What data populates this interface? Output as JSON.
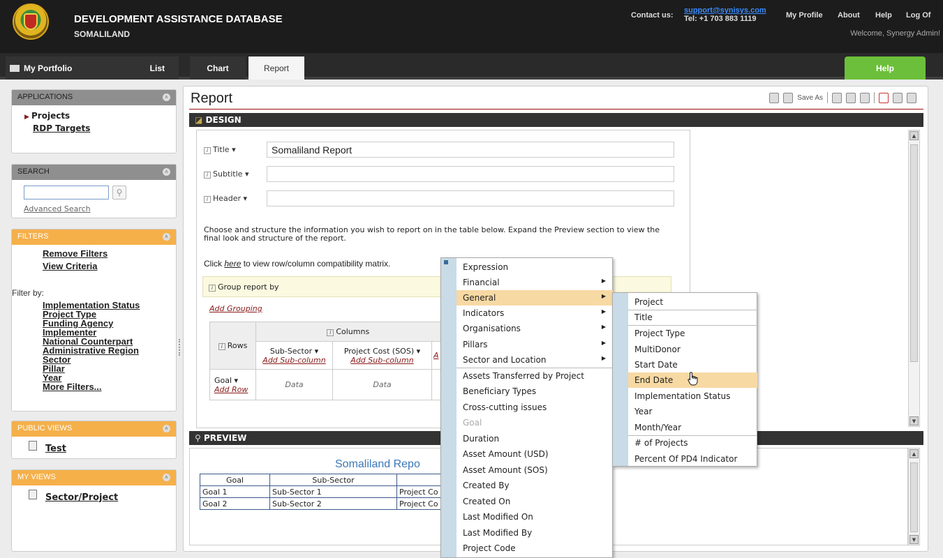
{
  "header": {
    "app_title": "DEVELOPMENT ASSISTANCE DATABASE",
    "app_subtitle": "SOMALILAND",
    "contact_label": "Contact us:",
    "contact_email": "support@synisys.com",
    "contact_tel": "Tel: +1 703 883 1119",
    "links": [
      "My Profile",
      "About",
      "Help",
      "Log Of"
    ],
    "welcome": "Welcome, Synergy Admin!"
  },
  "nav": {
    "portfolio": "My Portfolio",
    "list": "List",
    "chart": "Chart",
    "report": "Report",
    "help": "Help"
  },
  "sidebar": {
    "applications": {
      "title": "APPLICATIONS",
      "items": [
        "Projects",
        "RDP Targets"
      ]
    },
    "search": {
      "title": "SEARCH",
      "value": "",
      "advanced": "Advanced Search"
    },
    "filters": {
      "title": "FILTERS",
      "remove": "Remove Filters",
      "view": "View Criteria",
      "filter_by": "Filter by:",
      "items": [
        "Implementation Status",
        "Project Type",
        "Funding Agency",
        "Implementer",
        "National Counterpart",
        "Administrative Region",
        "Sector",
        "Pillar",
        "Year",
        "More Filters..."
      ]
    },
    "public_views": {
      "title": "PUBLIC VIEWS",
      "items": [
        "Test"
      ]
    },
    "my_views": {
      "title": "MY VIEWS",
      "items": [
        "Sector/Project"
      ]
    }
  },
  "main": {
    "title": "Report",
    "save_as": "Save As",
    "design_label": "DESIGN",
    "preview_label": "PREVIEW",
    "fields": {
      "title_label": "Title",
      "title_value": "Somaliland Report",
      "subtitle_label": "Subtitle",
      "subtitle_value": "",
      "header_label": "Header",
      "header_value": ""
    },
    "description": "Choose and structure the information you wish to report on in the table below. Expand the Preview section to view the final look and structure of the report.",
    "click_prefix": "Click ",
    "click_link": "here",
    "click_suffix": " to view row/column compatibility matrix.",
    "group_by": "Group report by",
    "add_grouping": "Add Grouping",
    "design_table": {
      "columns_label": "Columns",
      "rows_label": "Rows",
      "col1": "Sub-Sector",
      "col2": "Project Cost (SOS)",
      "add_subcolumn": "Add Sub-column",
      "row1": "Goal",
      "add_row": "Add Row",
      "data": "Data",
      "partial": "A"
    },
    "preview": {
      "title": "Somaliland Repo",
      "headers": [
        "Goal",
        "Sub-Sector",
        ""
      ],
      "rows": [
        [
          "Goal 1",
          "Sub-Sector 1",
          "Project Co"
        ],
        [
          "Goal 2",
          "Sub-Sector 2",
          "Project Co"
        ]
      ]
    }
  },
  "menu": {
    "items": [
      "Expression",
      "Financial",
      "General",
      "Indicators",
      "Organisations",
      "Pillars",
      "Sector and Location",
      "Assets Transferred by Project",
      "Beneficiary Types",
      "Cross-cutting issues",
      "Goal",
      "Duration",
      "Asset Amount (USD)",
      "Asset Amount (SOS)",
      "Created By",
      "Created On",
      "Last Modified On",
      "Last Modified By",
      "Project Code"
    ],
    "submenu": [
      "Project",
      "Title",
      "Project Type",
      "MultiDonor",
      "Start Date",
      "End Date",
      "Implementation Status",
      "Year",
      "Month/Year",
      "# of Projects",
      "Percent Of PD4 Indicator"
    ]
  }
}
